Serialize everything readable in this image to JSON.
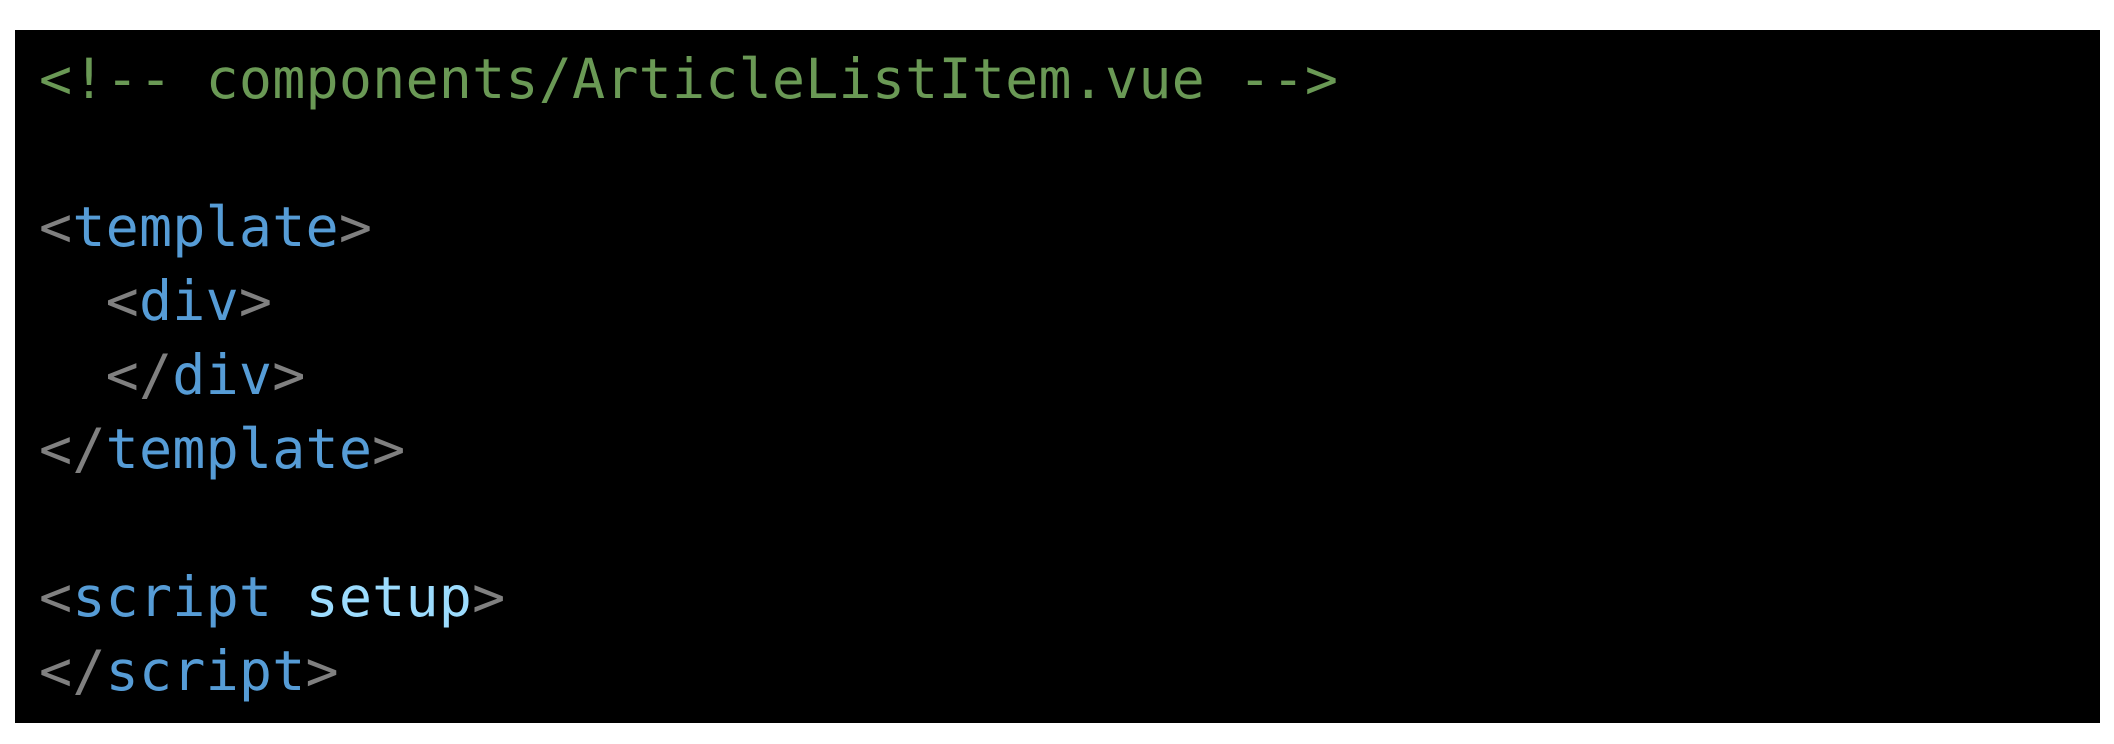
{
  "colors": {
    "background": "#000000",
    "page": "#ffffff",
    "comment": "#6a9955",
    "bracket": "#808080",
    "tag": "#569cd6",
    "attribute": "#9cdcfe"
  },
  "code": {
    "comment": "<!-- components/ArticleListItem.vue -->",
    "template_open": {
      "open": "<",
      "name": "template",
      "close": ">"
    },
    "div_open": {
      "indent": "  ",
      "open": "<",
      "name": "div",
      "close": ">"
    },
    "div_close": {
      "indent": "  ",
      "open": "</",
      "name": "div",
      "close": ">"
    },
    "template_close": {
      "open": "</",
      "name": "template",
      "close": ">"
    },
    "script_open": {
      "open": "<",
      "name": "script",
      "space": " ",
      "attr": "setup",
      "close": ">"
    },
    "script_close": {
      "open": "</",
      "name": "script",
      "close": ">"
    }
  }
}
